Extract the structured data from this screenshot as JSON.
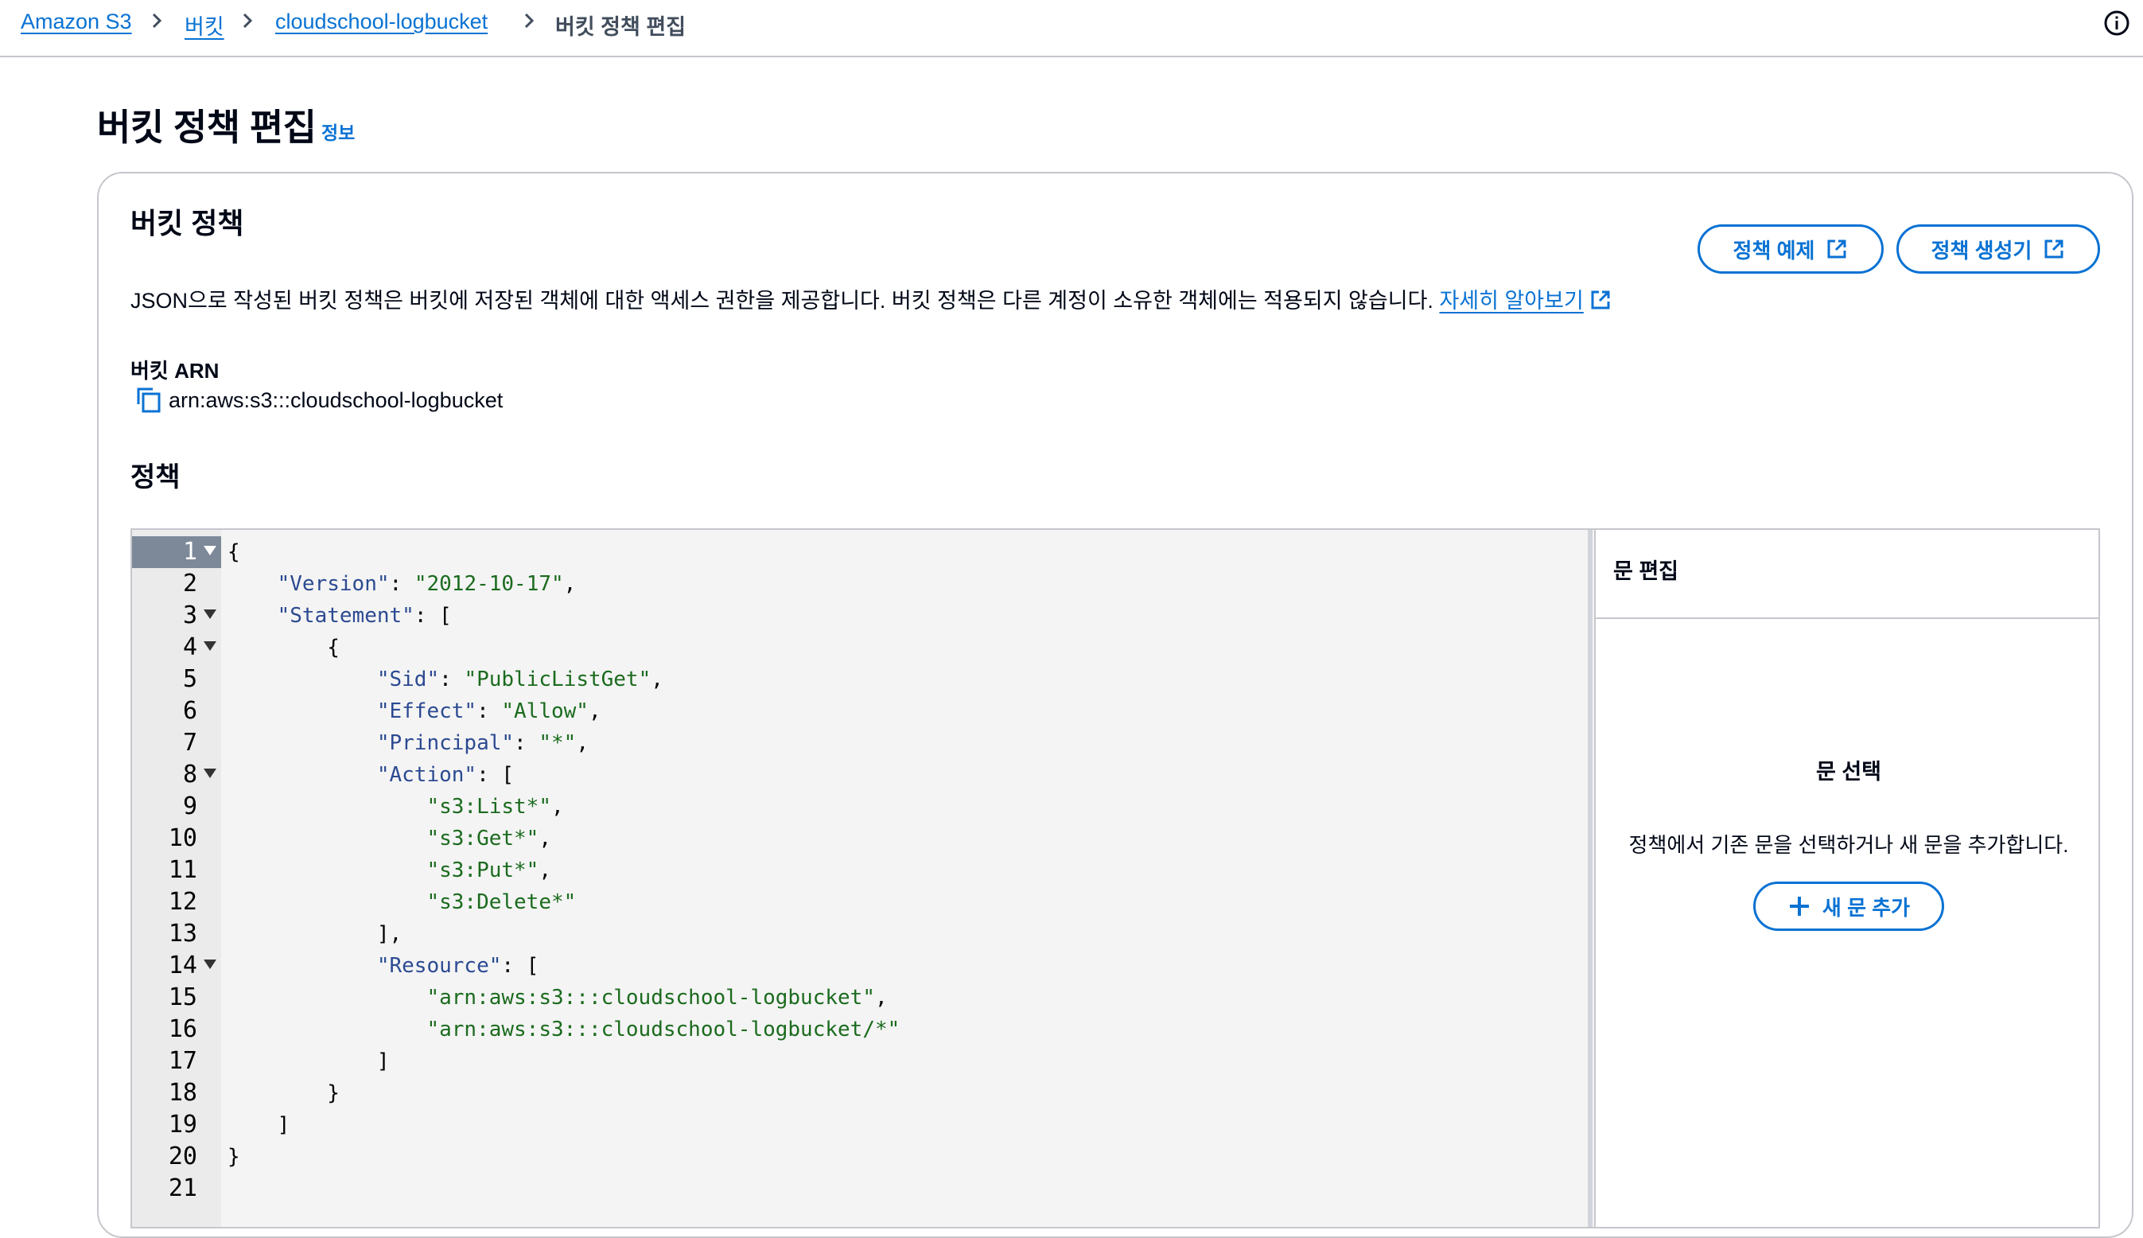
{
  "breadcrumb": {
    "items": [
      "Amazon S3",
      "버킷",
      "cloudschool-logbucket"
    ],
    "current": "버킷 정책 편집"
  },
  "page": {
    "title": "버킷 정책 편집",
    "info_link": "정보"
  },
  "bucket_policy": {
    "title": "버킷 정책",
    "policy_examples_button": "정책 예제",
    "policy_generator_button": "정책 생성기",
    "description": "JSON으로 작성된 버킷 정책은 버킷에 저장된 객체에 대한 액세스 권한을 제공합니다. 버킷 정책은 다른 계정이 소유한 객체에는 적용되지 않습니다.",
    "learn_more": "자세히 알아보기",
    "arn_label": "버킷 ARN",
    "arn_value": "arn:aws:s3:::cloudschool-logbucket",
    "policy_label": "정책"
  },
  "editor": {
    "lines": [
      "{",
      "    \"Version\": \"2012-10-17\",",
      "    \"Statement\": [",
      "        {",
      "            \"Sid\": \"PublicListGet\",",
      "            \"Effect\": \"Allow\",",
      "            \"Principal\": \"*\",",
      "            \"Action\": [",
      "                \"s3:List*\",",
      "                \"s3:Get*\",",
      "                \"s3:Put*\",",
      "                \"s3:Delete*\"",
      "            ],",
      "            \"Resource\": [",
      "                \"arn:aws:s3:::cloudschool-logbucket\",",
      "                \"arn:aws:s3:::cloudschool-logbucket/*\"",
      "            ]",
      "        }",
      "    ]",
      "}",
      ""
    ],
    "foldable_lines": [
      1,
      3,
      4,
      8,
      14
    ],
    "active_line": 1
  },
  "statement_panel": {
    "title": "문 편집",
    "empty_title": "문 선택",
    "empty_description": "정책에서 기존 문을 선택하거나 새 문을 추가합니다.",
    "add_button": "새 문 추가"
  },
  "colors": {
    "link": "#0972d3",
    "text": "#000716",
    "border": "#c6c6cd",
    "gutter": "#ebebeb",
    "code_bg": "#f4f4f4",
    "json_key": "#2c4a92",
    "json_string": "#1b6b1e"
  },
  "icons": [
    "chevron-right-icon",
    "info-icon",
    "external-link-icon",
    "copy-icon",
    "fold-arrow-icon",
    "plus-icon"
  ]
}
